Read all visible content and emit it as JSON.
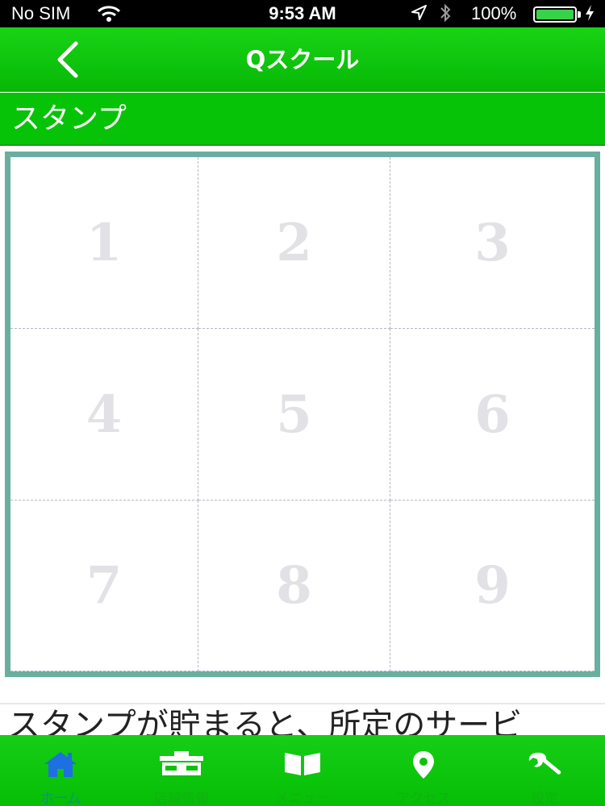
{
  "status_bar": {
    "carrier": "No SIM",
    "time": "9:53 AM",
    "battery_percent": "100%",
    "battery_level": 1.0
  },
  "nav": {
    "title": "Qスクール",
    "back_icon": "chevron-left-icon"
  },
  "section": {
    "title": "スタンプ"
  },
  "stamp_card": {
    "cells": [
      "1",
      "2",
      "3",
      "4",
      "5",
      "6",
      "7",
      "8",
      "9"
    ],
    "border_color": "#6aaea0"
  },
  "notice": {
    "text": "スタンプが貯まると、所定のサービ"
  },
  "tabs": [
    {
      "label": "ホーム",
      "icon": "home-icon",
      "active": true
    },
    {
      "label": "店舗情報",
      "icon": "shop-icon",
      "active": false
    },
    {
      "label": "メニュー",
      "icon": "book-icon",
      "active": false
    },
    {
      "label": "アクセス",
      "icon": "map-pin-icon",
      "active": false
    },
    {
      "label": "設定",
      "icon": "wrench-icon",
      "active": false
    }
  ],
  "colors": {
    "brand_green": "#07c307",
    "active_tab": "#1e6fe0"
  }
}
